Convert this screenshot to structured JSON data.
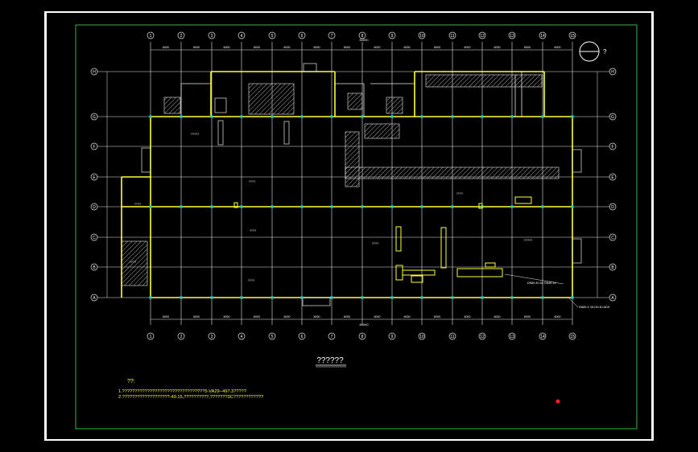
{
  "colors": {
    "background": "#000000",
    "panel_outer": "#ffffff",
    "sheet_border": "#2bbd3a",
    "wall": "#ffff33",
    "grid": "#e8e8e8",
    "column": "#22c8c8",
    "text": "#ffffff",
    "note_text": "#ffff33",
    "hatch": "#aaaaaa",
    "marker": "#ff2020"
  },
  "drawing": {
    "title": "??????",
    "north_label": "?",
    "notes_heading": "??:",
    "notes": [
      "1.?????????????????????????????????5-VA29--497.3?????",
      "2.???????????????????-49.15,??????????,???????3C????????????"
    ],
    "grid_axes_top": [
      "1",
      "2",
      "3",
      "4",
      "5",
      "6",
      "7",
      "8",
      "9",
      "10",
      "11",
      "12",
      "13",
      "14",
      "15"
    ],
    "grid_axes_left": [
      "A",
      "B",
      "C",
      "D",
      "E",
      "F",
      "G",
      "H"
    ],
    "dimensions_top": [
      "6000",
      "6000",
      "6000",
      "6000",
      "6000",
      "6000",
      "6000",
      "6000",
      "6000",
      "6000",
      "6000",
      "6000",
      "6000",
      "6000"
    ],
    "overall_dimension": "84000",
    "room_labels": [
      "?????",
      "????",
      "????",
      "????",
      "????",
      "????",
      "?????",
      "????",
      "????"
    ],
    "leader_labels": [
      "DN80-40-5X DN40-3X",
      "DN80-X 4S-DN 40-ADS"
    ]
  }
}
